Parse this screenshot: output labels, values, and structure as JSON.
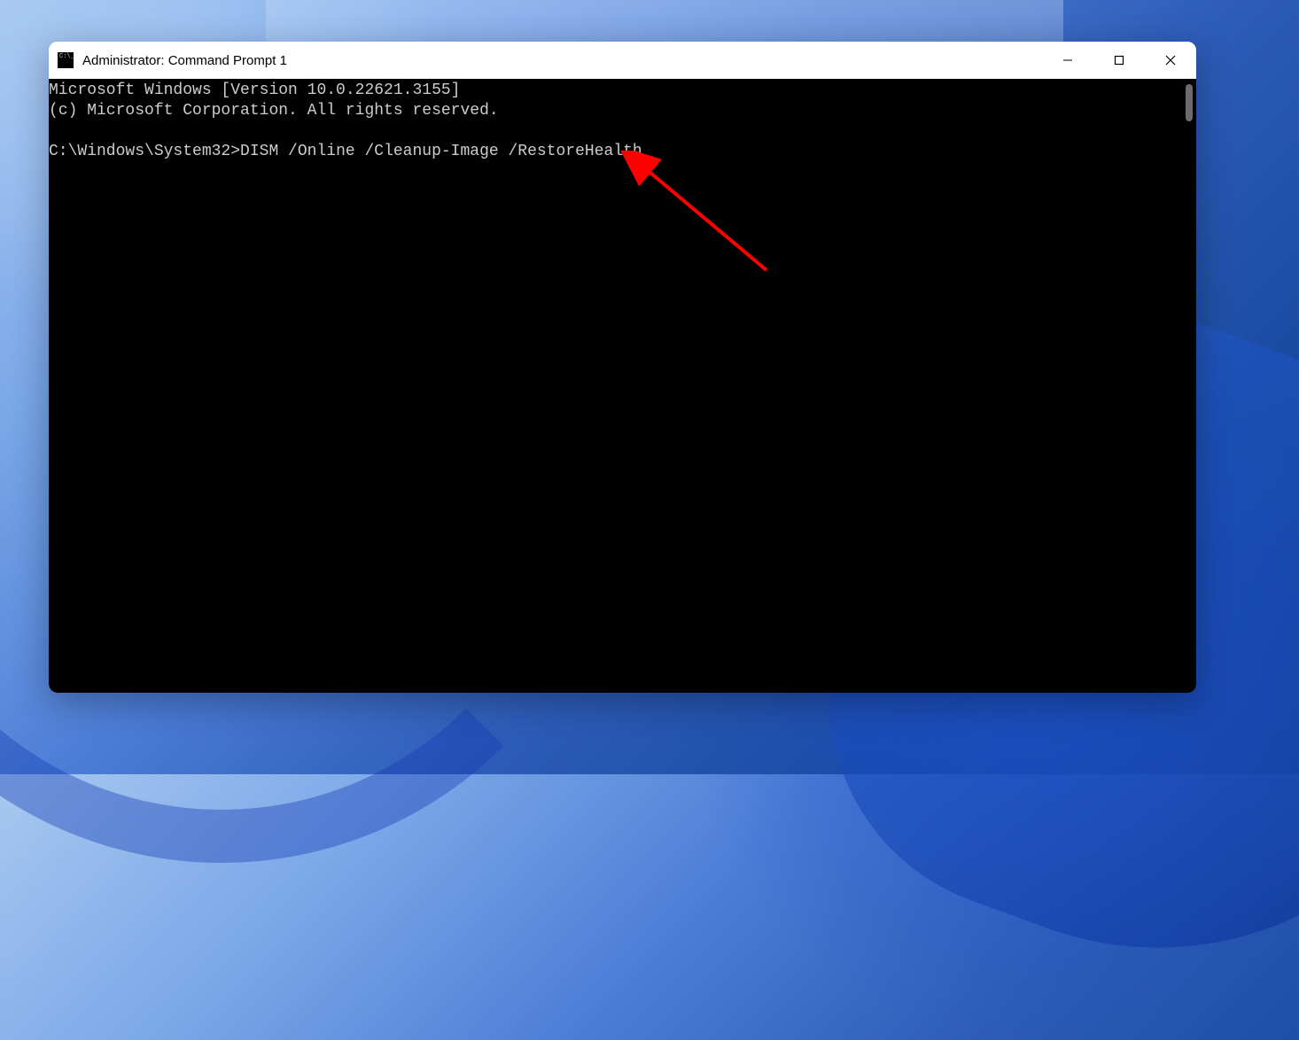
{
  "window": {
    "title": "Administrator: Command Prompt 1"
  },
  "terminal": {
    "line1": "Microsoft Windows [Version 10.0.22621.3155]",
    "line2": "(c) Microsoft Corporation. All rights reserved.",
    "blank": "",
    "prompt": "C:\\Windows\\System32>",
    "command": "DISM /Online /Cleanup-Image /RestoreHealth"
  },
  "annotation": {
    "arrow_color": "#ff0000"
  }
}
